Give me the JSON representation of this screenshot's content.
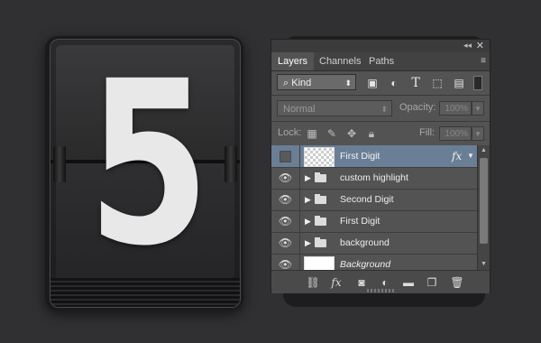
{
  "clock": {
    "digit": "5"
  },
  "panel": {
    "title_controls": {
      "collapse": "◂◂",
      "close": "✕"
    },
    "tabs": [
      {
        "label": "Layers",
        "active": true
      },
      {
        "label": "Channels",
        "active": false
      },
      {
        "label": "Paths",
        "active": false
      }
    ],
    "menu_icon": "≡",
    "filter": {
      "kind_label": "Kind",
      "search_glyph": "⌕",
      "icons": [
        "image-filter-icon",
        "adjustment-filter-icon",
        "type-filter-icon",
        "shape-filter-icon",
        "smart-object-filter-icon"
      ]
    },
    "blend_mode": "Normal",
    "opacity_label": "Opacity:",
    "opacity_value": "100%",
    "lock_label": "Lock:",
    "fill_label": "Fill:",
    "fill_value": "100%",
    "layers": [
      {
        "name": "First Digit",
        "visible": false,
        "type": "layer",
        "selected": true,
        "fx": "fx"
      },
      {
        "name": "custom highlight",
        "visible": true,
        "type": "group"
      },
      {
        "name": "Second Digit",
        "visible": true,
        "type": "group"
      },
      {
        "name": "First Digit",
        "visible": true,
        "type": "group"
      },
      {
        "name": "background",
        "visible": true,
        "type": "group"
      },
      {
        "name": "Background",
        "visible": true,
        "type": "layer-white"
      }
    ],
    "bottom_icons": [
      "link-icon",
      "fx-icon",
      "mask-icon",
      "adjustment-icon",
      "folder-icon",
      "new-layer-icon",
      "trash-icon"
    ]
  }
}
